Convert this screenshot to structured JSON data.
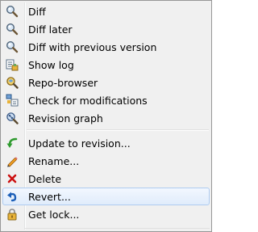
{
  "menu": {
    "group1": [
      {
        "label": "Diff",
        "icon": "magnifier-icon"
      },
      {
        "label": "Diff later",
        "icon": "magnifier-icon"
      },
      {
        "label": "Diff with previous version",
        "icon": "magnifier-icon"
      },
      {
        "label": "Show log",
        "icon": "log-icon"
      },
      {
        "label": "Repo-browser",
        "icon": "repo-browser-icon"
      },
      {
        "label": "Check for modifications",
        "icon": "check-modifications-icon"
      },
      {
        "label": "Revision graph",
        "icon": "revision-graph-icon"
      }
    ],
    "group2": [
      {
        "label": "Update to revision...",
        "icon": "update-arrow-icon"
      },
      {
        "label": "Rename...",
        "icon": "pencil-icon"
      },
      {
        "label": "Delete",
        "icon": "delete-x-icon"
      },
      {
        "label": "Revert...",
        "icon": "revert-arrow-icon"
      },
      {
        "label": "Get lock...",
        "icon": "padlock-icon"
      }
    ],
    "highlighted_item": "Revert...",
    "colors": {
      "background": "#f0f0f0",
      "border": "#979797",
      "highlight_border": "#aeccf1",
      "delete_red": "#cc1111",
      "update_green": "#2e9a2e",
      "revert_blue": "#1c5fb8"
    }
  }
}
